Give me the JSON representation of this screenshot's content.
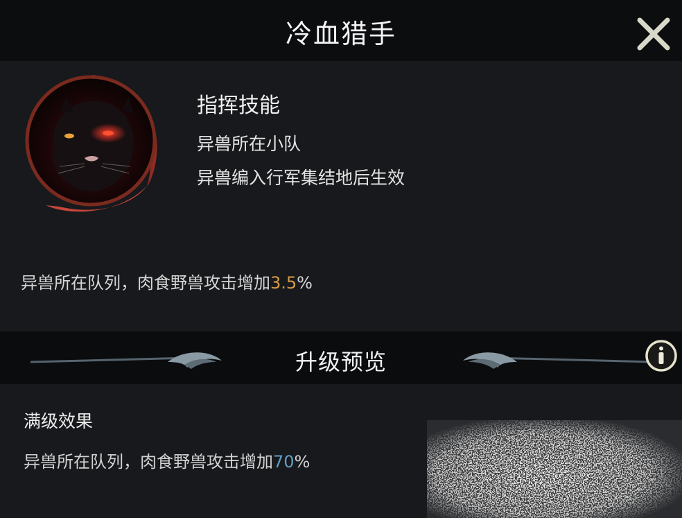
{
  "header": {
    "title": "冷血猎手"
  },
  "icons": {
    "close": "close-x-icon",
    "portrait": "black-panther-portrait",
    "info": "info-icon"
  },
  "skill": {
    "type": "指挥技能",
    "scope": "异兽所在小队",
    "condition": "异兽编入行军集结地后生效",
    "current_effect_text": "异兽所在队列，肉食野兽攻击增加",
    "current_value": "3.5",
    "percent": "%"
  },
  "upgrade": {
    "title": "升级预览",
    "max_label": "满级效果",
    "max_effect_text": "异兽所在队列，肉食野兽攻击增加",
    "max_value": "70",
    "percent": "%"
  },
  "colors": {
    "highlight_current": "#d99a42",
    "highlight_max": "#5f9fc2",
    "panel_bg": "#17191c",
    "bar_bg": "#0b0c0e"
  }
}
